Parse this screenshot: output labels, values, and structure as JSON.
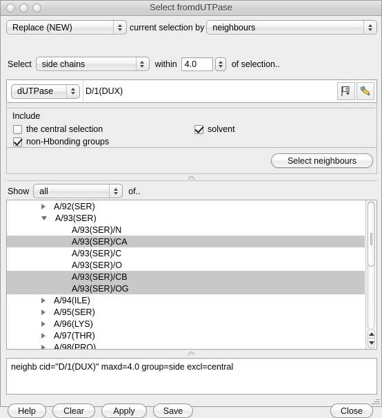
{
  "window": {
    "title": "Select fromdUTPase",
    "traffic_lights": [
      "close-button",
      "minimize-button",
      "zoom-button"
    ]
  },
  "top_row": {
    "mode_select": {
      "value": "Replace (NEW)"
    },
    "middle_label": "current selection by",
    "criterion_select": {
      "value": "neighbours"
    }
  },
  "select_row": {
    "select_label": "Select",
    "group_select": {
      "value": "side chains"
    },
    "within_label": "within",
    "distance_value": "4.0",
    "of_selection_label": "of selection.."
  },
  "target_row": {
    "molecule_select": {
      "value": "dUTPase"
    },
    "selection_text": "D/1(DUX)",
    "pick_icon": "pick-selection-icon",
    "brush_icon": "paintbrush-icon"
  },
  "include_group": {
    "legend": "Include",
    "checkboxes": [
      {
        "label": "the central selection",
        "checked": false
      },
      {
        "label": "solvent",
        "checked": true
      },
      {
        "label": "non-Hbonding groups",
        "checked": true
      }
    ],
    "action_button": "Select neighbours"
  },
  "show_row": {
    "show_label": "Show",
    "filter_select": {
      "value": "all"
    },
    "of_label": "of.."
  },
  "tree": {
    "items": [
      {
        "label": "A/92(SER)",
        "depth": 0,
        "disclosure": "collapsed",
        "selected": false
      },
      {
        "label": "A/93(SER)",
        "depth": 0,
        "disclosure": "expanded",
        "selected": false
      },
      {
        "label": "A/93(SER)/N",
        "depth": 1,
        "disclosure": "none",
        "selected": false
      },
      {
        "label": "A/93(SER)/CA",
        "depth": 1,
        "disclosure": "none",
        "selected": true
      },
      {
        "label": "A/93(SER)/C",
        "depth": 1,
        "disclosure": "none",
        "selected": false
      },
      {
        "label": "A/93(SER)/O",
        "depth": 1,
        "disclosure": "none",
        "selected": false
      },
      {
        "label": "A/93(SER)/CB",
        "depth": 1,
        "disclosure": "none",
        "selected": true
      },
      {
        "label": "A/93(SER)/OG",
        "depth": 1,
        "disclosure": "none",
        "selected": true
      },
      {
        "label": "A/94(ILE)",
        "depth": 0,
        "disclosure": "collapsed",
        "selected": false
      },
      {
        "label": "A/95(SER)",
        "depth": 0,
        "disclosure": "collapsed",
        "selected": false
      },
      {
        "label": "A/96(LYS)",
        "depth": 0,
        "disclosure": "collapsed",
        "selected": false
      },
      {
        "label": "A/97(THR)",
        "depth": 0,
        "disclosure": "collapsed",
        "selected": false
      },
      {
        "label": "A/98(PRO)",
        "depth": 0,
        "disclosure": "collapsed",
        "selected": false
      }
    ],
    "scrollbar": {
      "orientation": "vertical"
    }
  },
  "command": {
    "text": "neighb cid=\"D/1(DUX)\" maxd=4.0 group=side excl=central"
  },
  "footer": {
    "buttons": [
      {
        "label": "Help"
      },
      {
        "label": "Clear"
      },
      {
        "label": "Apply"
      },
      {
        "label": "Save"
      }
    ],
    "close_label": "Close"
  },
  "colors": {
    "window_bg": "#ededed",
    "selection_row": "#c8c8c8",
    "field_bg": "#ffffff",
    "border": "#a6a6a6"
  }
}
